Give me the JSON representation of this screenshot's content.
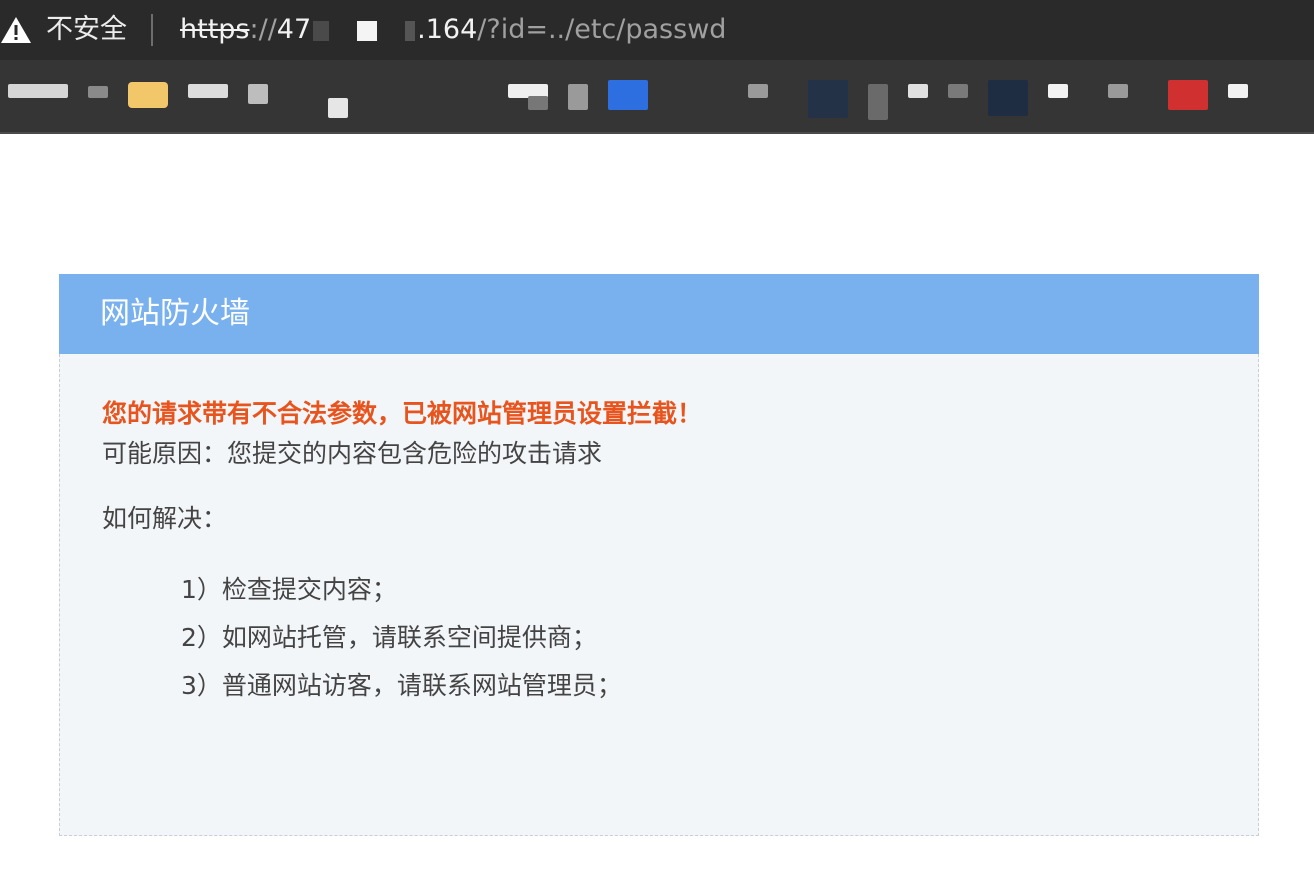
{
  "browser": {
    "insecure_label": "不安全",
    "url": {
      "scheme": "https",
      "sep": "://",
      "host_start": "47",
      "host_end": ".164",
      "path": "/?id=../etc/passwd"
    }
  },
  "firewall": {
    "title": "网站防火墙",
    "alert": "您的请求带有不合法参数，已被网站管理员设置拦截！",
    "reason": "可能原因：您提交的内容包含危险的攻击请求",
    "howto_label": "如何解决：",
    "steps": [
      "1）检查提交内容；",
      "2）如网站托管，请联系空间提供商；",
      "3）普通网站访客，请联系网站管理员；"
    ]
  },
  "colors": {
    "header_blue": "#79b1ef",
    "alert_orange": "#e8541d",
    "body_bg": "#f3f6f9",
    "toolbar_bg": "#2a2a2a"
  }
}
